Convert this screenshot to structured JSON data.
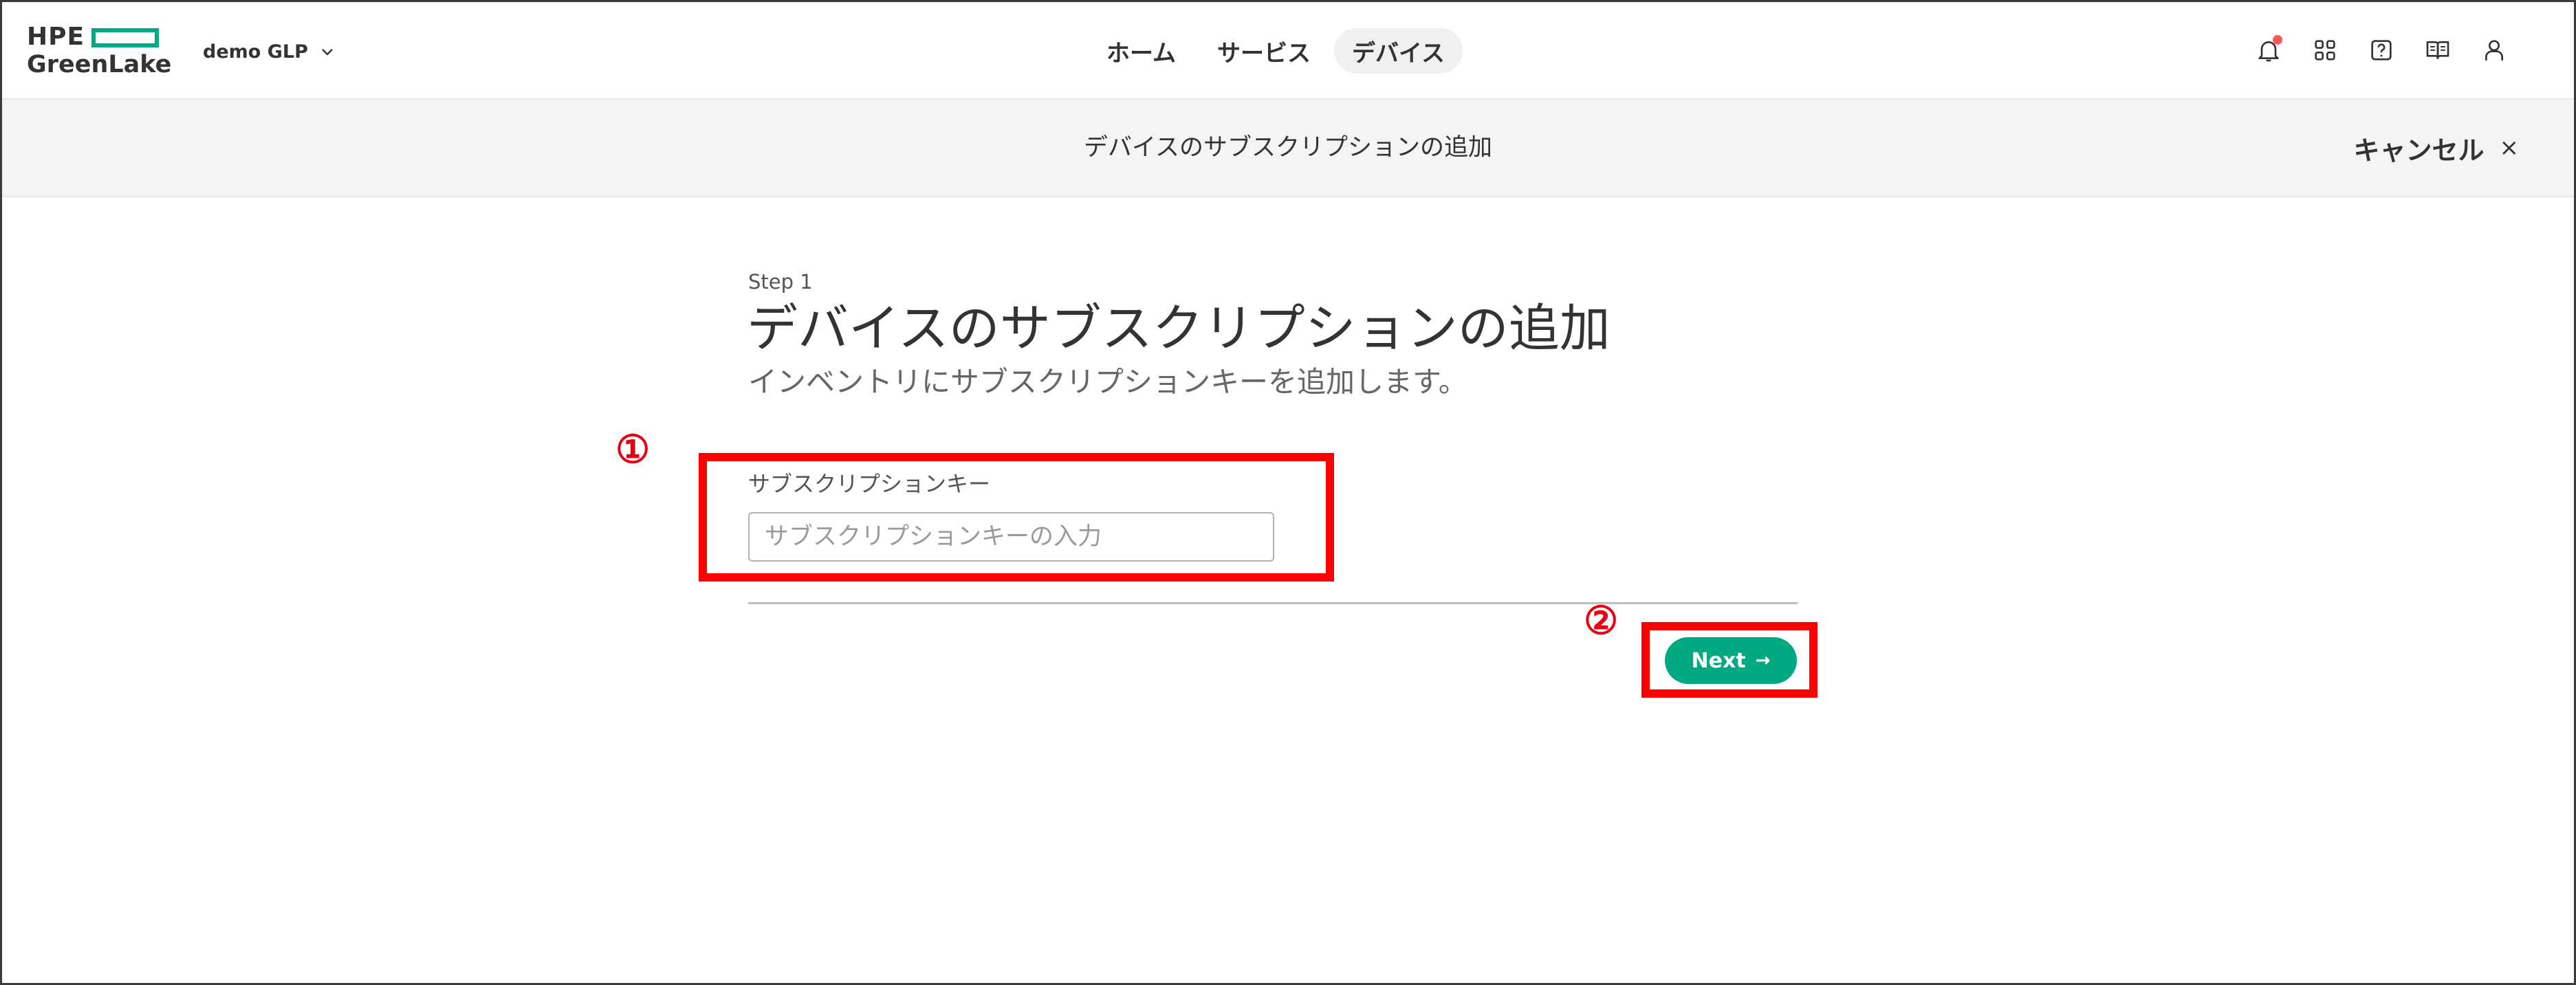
{
  "header": {
    "logo_line1": "HPE",
    "logo_line2": "GreenLake",
    "workspace": "demo GLP",
    "nav": [
      {
        "label": "ホーム"
      },
      {
        "label": "サービス"
      },
      {
        "label": "デバイス"
      }
    ],
    "active_nav": "デバイス",
    "icons": [
      "bell-icon",
      "apps-grid-icon",
      "help-icon",
      "book-icon",
      "user-icon"
    ]
  },
  "subbar": {
    "title": "デバイスのサブスクリプションの追加",
    "cancel_label": "キャンセル",
    "cancel_icon": "×"
  },
  "main": {
    "step_label": "Step 1",
    "title": "デバイスのサブスクリプションの追加",
    "subtitle": "インベントリにサブスクリプションキーを追加します。",
    "field_label": "サブスクリプションキー",
    "field_placeholder": "サブスクリプションキーの入力",
    "field_value": "",
    "next_label": "Next",
    "next_arrow": "→"
  },
  "annotations": [
    {
      "number": "①"
    },
    {
      "number": "②"
    }
  ],
  "colors": {
    "brand_green": "#01a982",
    "annotation_red": "#ff0000",
    "notification_dot": "#fc5a5a"
  }
}
